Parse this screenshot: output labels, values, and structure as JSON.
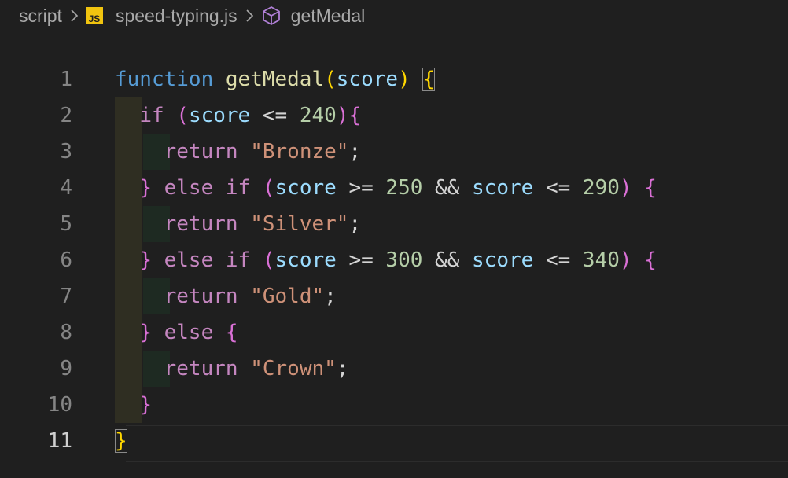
{
  "breadcrumb": {
    "folder": "script",
    "file_icon_text": "JS",
    "file": "speed-typing.js",
    "symbol": "getMedal"
  },
  "editor": {
    "line_numbers": [
      "1",
      "2",
      "3",
      "4",
      "5",
      "6",
      "7",
      "8",
      "9",
      "10",
      "11"
    ],
    "lines": {
      "l1": {
        "kw": "function",
        "fn": "getMedal",
        "open": "(",
        "param": "score",
        "close": ")",
        "brace": "{"
      },
      "l2": {
        "kw": "if",
        "open": "(",
        "var": "score",
        "op": "<=",
        "num": "240",
        "close": ")",
        "brace": "{"
      },
      "l3": {
        "kw": "return",
        "str": "\"Bronze\"",
        "semi": ";"
      },
      "l4": {
        "brace_close": "}",
        "kw": "else if",
        "open": "(",
        "var1": "score",
        "op1": ">=",
        "num1": "250",
        "and": "&&",
        "var2": "score",
        "op2": "<=",
        "num2": "290",
        "close": ")",
        "brace": "{"
      },
      "l5": {
        "kw": "return",
        "str": "\"Silver\"",
        "semi": ";"
      },
      "l6": {
        "brace_close": "}",
        "kw": "else if",
        "open": "(",
        "var1": "score",
        "op1": ">=",
        "num1": "300",
        "and": "&&",
        "var2": "score",
        "op2": "<=",
        "num2": "340",
        "close": ")",
        "brace": "{"
      },
      "l7": {
        "kw": "return",
        "str": "\"Gold\"",
        "semi": ";"
      },
      "l8": {
        "brace_close": "}",
        "kw": "else",
        "brace": "{"
      },
      "l9": {
        "kw": "return",
        "str": "\"Crown\"",
        "semi": ";"
      },
      "l10": {
        "brace_close": "}"
      },
      "l11": {
        "brace_close": "}"
      }
    }
  },
  "colors": {
    "background": "#1f1f1f",
    "keyword": "#569cd6",
    "control": "#c586c0",
    "function": "#dcdcaa",
    "variable": "#9cdcfe",
    "number": "#b5cea8",
    "string": "#ce9178",
    "bracket_level1": "#ffd700",
    "bracket_level2": "#da70d6"
  }
}
